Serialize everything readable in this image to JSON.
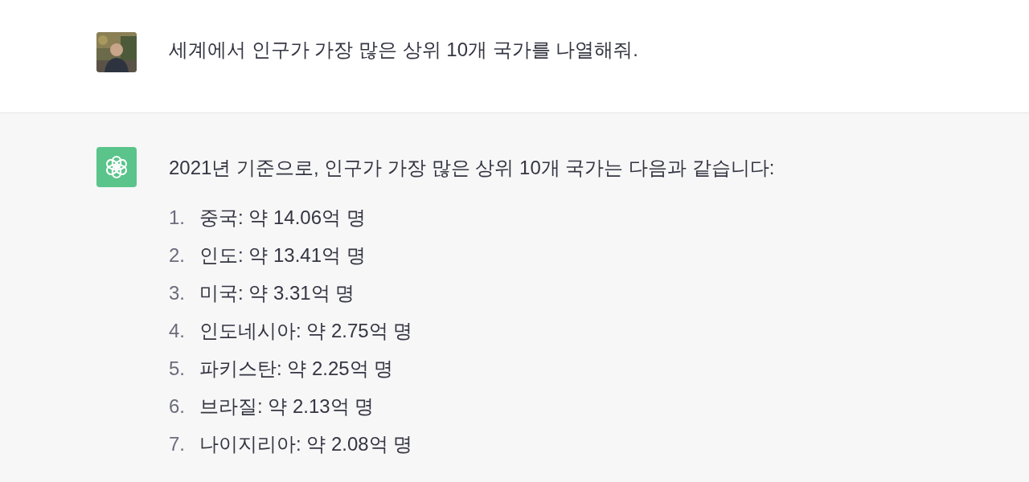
{
  "messages": [
    {
      "kind": "user",
      "text": "세계에서 인구가 가장 많은 상위 10개 국가를 나열해줘."
    },
    {
      "kind": "assistant",
      "text": "2021년 기준으로, 인구가 가장 많은 상위 10개 국가는 다음과 같습니다:",
      "list": [
        {
          "number": "1.",
          "text": "중국: 약 14.06억 명"
        },
        {
          "number": "2.",
          "text": "인도: 약 13.41억 명"
        },
        {
          "number": "3.",
          "text": "미국: 약 3.31억 명"
        },
        {
          "number": "4.",
          "text": "인도네시아: 약 2.75억 명"
        },
        {
          "number": "5.",
          "text": "파키스탄: 약 2.25억 명"
        },
        {
          "number": "6.",
          "text": "브라질: 약 2.13억 명"
        },
        {
          "number": "7.",
          "text": "나이지리아: 약 2.08억 명"
        }
      ]
    }
  ]
}
